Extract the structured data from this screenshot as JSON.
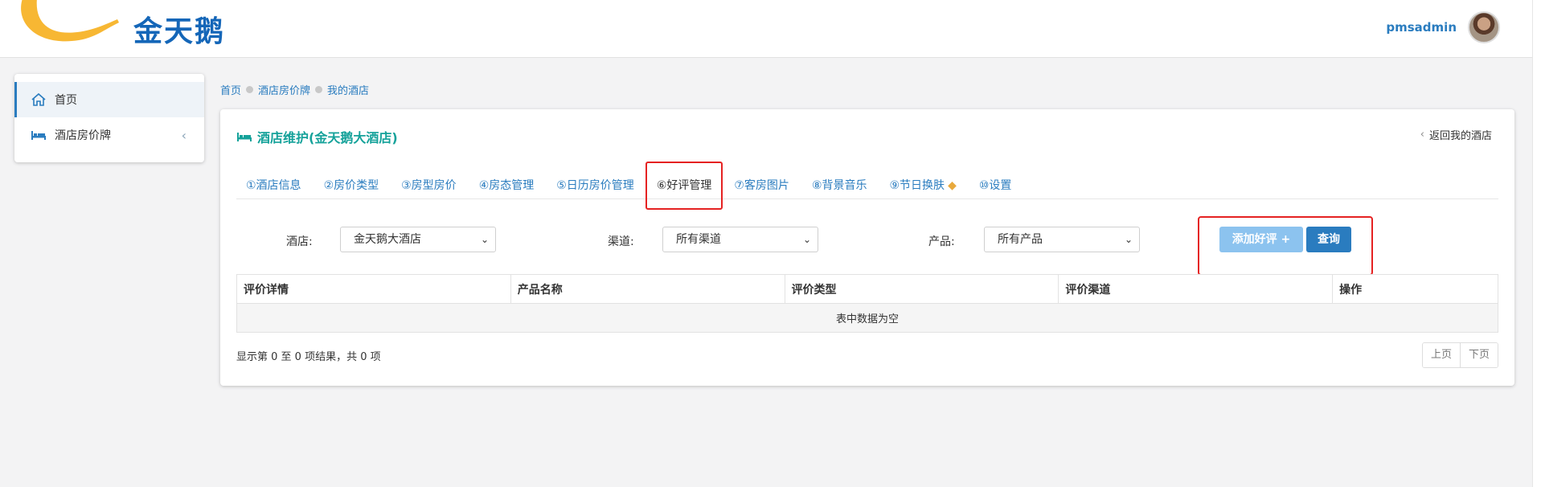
{
  "header": {
    "logo_text": "金天鹅",
    "username": "pmsadmin"
  },
  "sidebar": {
    "items": [
      {
        "label": "首页",
        "icon": "home-icon",
        "active": true
      },
      {
        "label": "酒店房价牌",
        "icon": "bed-icon",
        "active": false
      }
    ]
  },
  "breadcrumb": [
    "首页",
    "酒店房价牌",
    "我的酒店"
  ],
  "panel": {
    "title": "酒店维护(金天鹅大酒店)",
    "back_label": "返回我的酒店"
  },
  "tabs": [
    {
      "label": "①酒店信息"
    },
    {
      "label": "②房价类型"
    },
    {
      "label": "③房型房价"
    },
    {
      "label": "④房态管理"
    },
    {
      "label": "⑤日历房价管理"
    },
    {
      "label": "⑥好评管理",
      "active": true
    },
    {
      "label": "⑦客房图片"
    },
    {
      "label": "⑧背景音乐"
    },
    {
      "label": "⑨节日换肤",
      "icon": "diamond-icon"
    },
    {
      "label": "⑩设置"
    }
  ],
  "filters": {
    "hotel_label": "酒店:",
    "hotel_value": "金天鹅大酒店",
    "channel_label": "渠道:",
    "channel_value": "所有渠道",
    "product_label": "产品:",
    "product_value": "所有产品",
    "add_button": "添加好评 +",
    "query_button": "查询"
  },
  "table": {
    "columns": [
      "评价详情",
      "产品名称",
      "评价类型",
      "评价渠道",
      "操作"
    ],
    "empty_text": "表中数据为空"
  },
  "footer": {
    "info": "显示第 0 至 0 项结果，共 0 项",
    "prev": "上页",
    "next": "下页"
  },
  "colors": {
    "accent": "#2a7cbf",
    "title": "#15a29a",
    "highlight": "#e52222",
    "add_button": "#8cc3ef"
  }
}
